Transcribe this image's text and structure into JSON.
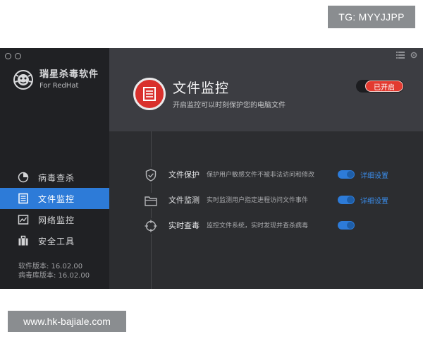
{
  "watermarks": {
    "top": "TG: MYYJJPP",
    "bottom": "www.hk-bajiale.com"
  },
  "app": {
    "name": "瑞星杀毒软件",
    "subtitle": "For RedHat"
  },
  "sidebar": {
    "items": [
      {
        "label": "病毒查杀",
        "icon": "pie-chart-icon",
        "active": false
      },
      {
        "label": "文件监控",
        "icon": "file-monitor-icon",
        "active": true
      },
      {
        "label": "网络监控",
        "icon": "network-chart-icon",
        "active": false
      },
      {
        "label": "安全工具",
        "icon": "toolbox-icon",
        "active": false
      }
    ],
    "versions": {
      "software": "软件版本: 16.02.00",
      "virus_db": "病毒库版本: 16.02.00"
    }
  },
  "header": {
    "title": "文件监控",
    "description": "开启监控可以时刻保护您的电脑文件",
    "status_label": "已开启",
    "icon": "file-monitor-icon"
  },
  "features": [
    {
      "title": "文件保护",
      "description": "保护用户敏感文件不被非法访问和修改",
      "enabled": true,
      "link": "详细设置",
      "icon": "shield-check-icon"
    },
    {
      "title": "文件监测",
      "description": "实时监测用户指定进程访问文件事件",
      "enabled": true,
      "link": "详细设置",
      "icon": "folder-icon"
    },
    {
      "title": "实时查毒",
      "description": "监控文件系统，实时发现并查杀病毒",
      "enabled": true,
      "link": "",
      "icon": "crosshair-icon"
    }
  ],
  "colors": {
    "accent": "#2d7bd8",
    "danger": "#e23a30",
    "sidebar_bg": "#202124",
    "header_bg": "#3c3d42"
  }
}
